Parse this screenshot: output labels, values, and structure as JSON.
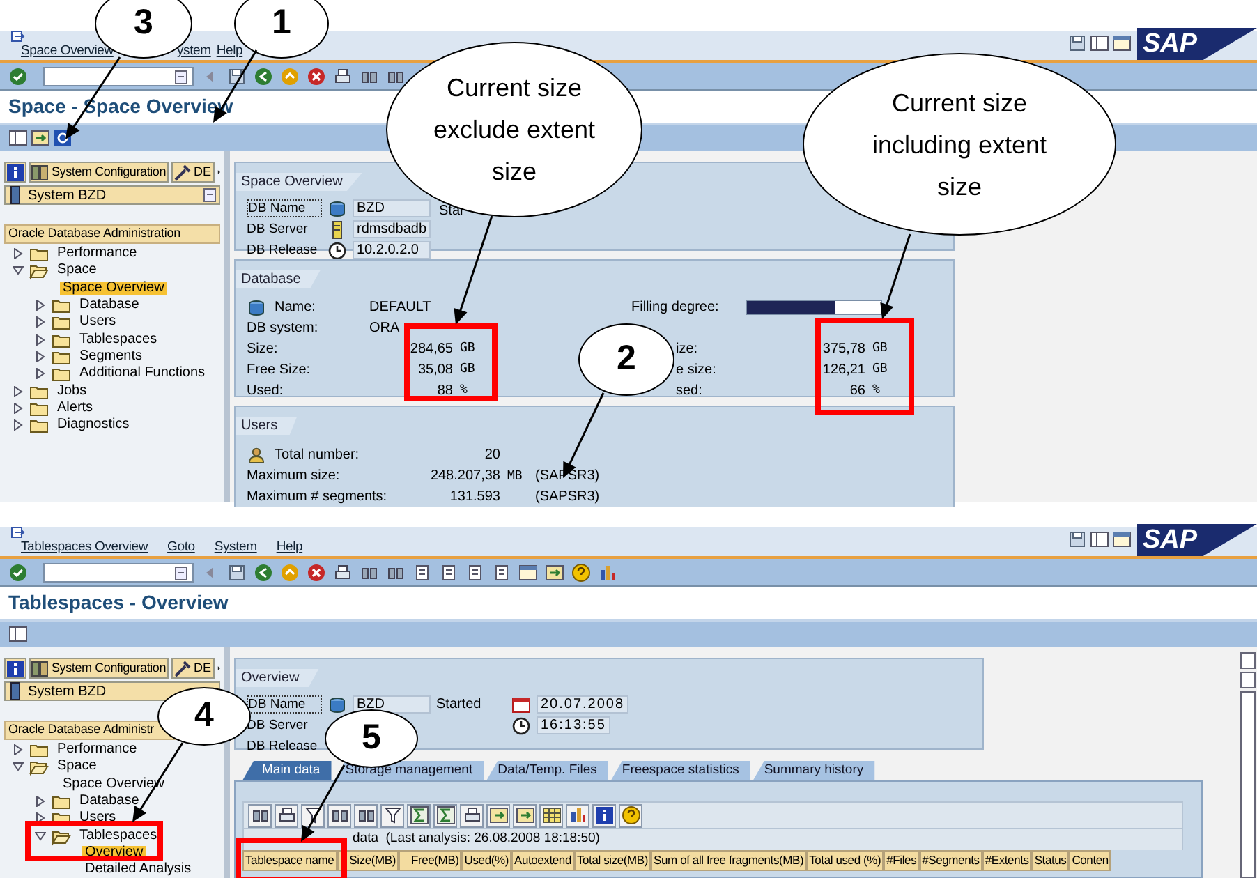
{
  "space_window": {
    "menu": [
      "Space Overview",
      "ystem",
      "Help"
    ],
    "logo": "SAP",
    "title": "Space - Space Overview",
    "navigator": {
      "tabs": [
        "System Configuration",
        "DE"
      ],
      "system": "System BZD",
      "header": "Oracle Database Administration"
    },
    "tree": [
      {
        "kind": "folder",
        "label": "Performance",
        "expanded": false,
        "selected": false
      },
      {
        "kind": "folder",
        "label": "Space",
        "expanded": true,
        "selected": false,
        "children": [
          {
            "kind": "leaf",
            "label": "Space Overview",
            "selected": true
          },
          {
            "kind": "folder",
            "label": "Database",
            "expanded": false,
            "selected": false
          },
          {
            "kind": "folder",
            "label": "Users",
            "expanded": false,
            "selected": false
          },
          {
            "kind": "folder",
            "label": "Tablespaces",
            "expanded": false,
            "selected": false
          },
          {
            "kind": "folder",
            "label": "Segments",
            "expanded": false,
            "selected": false
          },
          {
            "kind": "folder",
            "label": "Additional Functions",
            "expanded": false,
            "selected": false
          }
        ]
      },
      {
        "kind": "folder",
        "label": "Jobs",
        "expanded": false,
        "selected": false
      },
      {
        "kind": "folder",
        "label": "Alerts",
        "expanded": false,
        "selected": false
      },
      {
        "kind": "folder",
        "label": "Diagnostics",
        "expanded": false,
        "selected": false
      }
    ],
    "overview": {
      "title": "Space Overview",
      "fields": [
        {
          "label": "DB Name",
          "value": "BZD"
        },
        {
          "label": "DB Server",
          "value": "rdmsdbadb"
        },
        {
          "label": "DB Release",
          "value": "10.2.0.2.0"
        }
      ],
      "started_label": "Star"
    },
    "database": {
      "title": "Database",
      "left": [
        {
          "label": "Name:",
          "value": "DEFAULT"
        },
        {
          "label": "DB system:",
          "value": "ORA"
        },
        {
          "label": "Size:",
          "value": "284,65",
          "unit": "GB"
        },
        {
          "label": "Free Size:",
          "value": "35,08",
          "unit": "GB"
        },
        {
          "label": "Used:",
          "value": "88",
          "unit": "%"
        }
      ],
      "filling": {
        "label": "Filling degree:",
        "level": 0.66
      },
      "right": [
        {
          "label": "ize:",
          "value": "375,78",
          "unit": "GB"
        },
        {
          "label": "e size:",
          "value": "126,21",
          "unit": "GB"
        },
        {
          "label": "sed:",
          "value": "66",
          "unit": "%"
        }
      ]
    },
    "users": {
      "title": "Users",
      "rows": [
        {
          "label": "Total number:",
          "value": "20"
        },
        {
          "label": "Maximum size:",
          "value": "248.207,38",
          "unit": "MB",
          "owner": "(SAPSR3)"
        },
        {
          "label": "Maximum # segments:",
          "value": "131.593",
          "owner": "(SAPSR3)"
        }
      ]
    }
  },
  "tablespaces_window": {
    "menu": [
      "Tablespaces Overview",
      "Goto",
      "System",
      "Help"
    ],
    "logo": "SAP",
    "title": "Tablespaces - Overview",
    "navigator": {
      "tabs": [
        "System Configuration",
        "DE"
      ],
      "system": "System BZD",
      "header": "Oracle Database Administr"
    },
    "tree": [
      {
        "kind": "folder",
        "label": "Performance",
        "expanded": false,
        "selected": false
      },
      {
        "kind": "folder",
        "label": "Space",
        "expanded": true,
        "selected": false,
        "children": [
          {
            "kind": "leaf",
            "label": "Space Overview",
            "selected": false
          },
          {
            "kind": "folder",
            "label": "Database",
            "expanded": false,
            "selected": false
          },
          {
            "kind": "folder",
            "label": "Users",
            "expanded": false,
            "selected": false
          },
          {
            "kind": "folder",
            "label": "Tablespaces",
            "expanded": true,
            "selected": false,
            "children": [
              {
                "kind": "leaf",
                "label": "Overview",
                "selected": true
              },
              {
                "kind": "leaf",
                "label": "Detailed Analysis",
                "selected": false
              }
            ]
          }
        ]
      }
    ],
    "overview": {
      "title": "Overview",
      "fields": [
        {
          "label": "DB Name",
          "value": "BZD"
        },
        {
          "label": "DB Server"
        },
        {
          "label": "DB Release"
        }
      ],
      "started_label": "Started",
      "date": "20.07.2008",
      "time": "16:13:55"
    },
    "tabs": [
      {
        "label": "Main data",
        "selected": true
      },
      {
        "label": "Storage management",
        "selected": false
      },
      {
        "label": "Data/Temp. Files",
        "selected": false
      },
      {
        "label": "Freespace statistics",
        "selected": false
      },
      {
        "label": "Summary history",
        "selected": false
      }
    ],
    "table_title": "data  (Last analysis: 26.08.2008 18:18:50)",
    "columns": [
      "Tablespace name",
      "Size(MB)",
      "Free(MB)",
      "Used(%)",
      "Autoextend",
      "Total size(MB)",
      "Sum of all free fragments(MB)",
      "Total used (%)",
      "#Files",
      "#Segments",
      "#Extents",
      "Status",
      "Conten"
    ]
  },
  "callouts": [
    {
      "text": "3"
    },
    {
      "text": "1"
    },
    {
      "text": "Current size exclude extent size"
    },
    {
      "text": "Current size including extent size"
    },
    {
      "text": "2"
    },
    {
      "text": "4"
    },
    {
      "text": "5"
    }
  ]
}
